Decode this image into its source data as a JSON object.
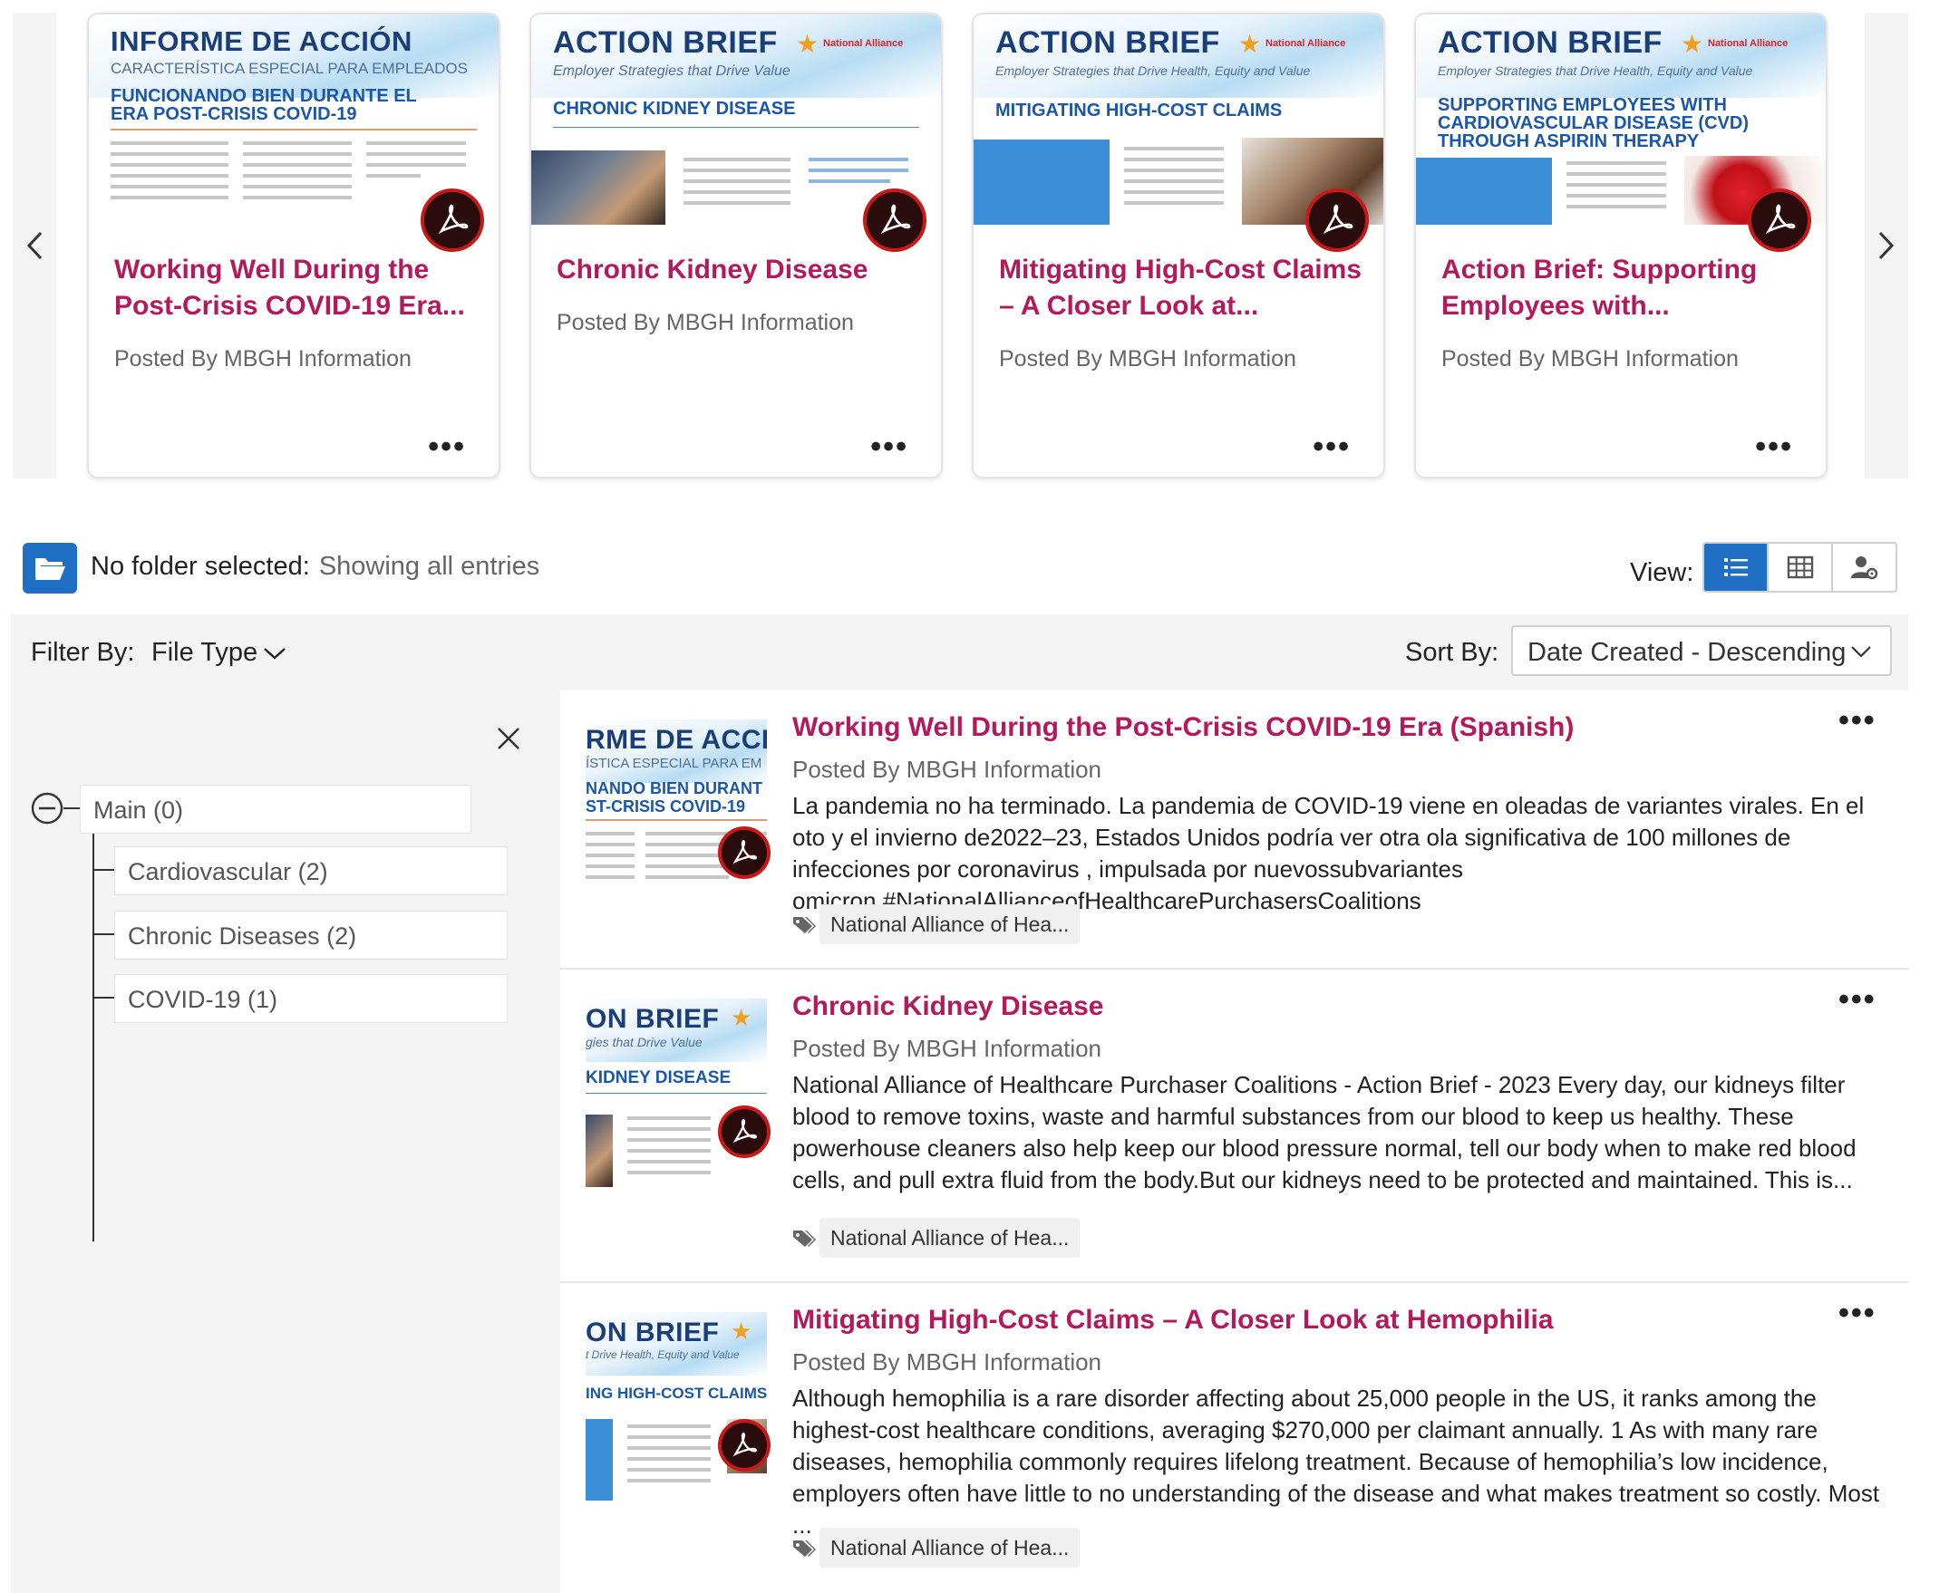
{
  "carousel": {
    "cards": [
      {
        "title": "Working Well During the Post-Crisis COVID-19 Era...",
        "posted": "Posted By MBGH Information",
        "thumb": {
          "h1": "INFORME DE ACCIÓN",
          "h1s": "CARACTERÍSTICA ESPECIAL PARA EMPLEADOS",
          "sub1": "FUNCIONANDO BIEN DURANTE EL",
          "sub2": "ERA POST-CRISIS COVID-19",
          "brand": ""
        }
      },
      {
        "title": "Chronic Kidney Disease",
        "posted": "Posted By MBGH Information",
        "thumb": {
          "h1": "ACTION BRIEF",
          "h1s": "Employer Strategies that Drive Value",
          "sub1": "CHRONIC KIDNEY DISEASE",
          "sub2": "",
          "brand": "National Alliance"
        }
      },
      {
        "title": "Mitigating High-Cost Claims – A Closer Look at...",
        "posted": "Posted By MBGH Information",
        "thumb": {
          "h1": "ACTION BRIEF",
          "h1s": "Employer Strategies that Drive Health, Equity and Value",
          "sub1": "MITIGATING HIGH-COST CLAIMS",
          "sub2": "",
          "brand": "National Alliance"
        }
      },
      {
        "title": "Action Brief: Supporting Employees with...",
        "posted": "Posted By MBGH Information",
        "thumb": {
          "h1": "ACTION BRIEF",
          "h1s": "Employer Strategies that Drive Health, Equity and Value",
          "sub1": "SUPPORTING EMPLOYEES WITH",
          "sub2": "CARDIOVASCULAR DISEASE (CVD)",
          "sub3": "THROUGH ASPIRIN THERAPY",
          "brand": "National Alliance"
        }
      }
    ],
    "more_label": "•••"
  },
  "folder": {
    "label": "No folder selected:",
    "value": "Showing all entries"
  },
  "view": {
    "label": "View:",
    "modes": [
      "list",
      "grid",
      "user-settings"
    ],
    "active": "list"
  },
  "filter": {
    "label": "Filter By:",
    "type_label": "File Type"
  },
  "sort": {
    "label": "Sort By:",
    "value": "Date Created - Descending"
  },
  "tree": {
    "root": "Main (0)",
    "children": [
      "Cardiovascular (2)",
      "Chronic Diseases (2)",
      "COVID-19 (1)"
    ]
  },
  "entries": [
    {
      "title": "Working Well During the Post-Crisis COVID-19 Era (Spanish)",
      "posted": "Posted By MBGH Information",
      "description": "La pandemia no ha terminado. La pandemia de COVID-19 viene en oleadas de variantes virales. En el oto y el invierno de2022–23, Estados Unidos podría ver otra ola significativa de 100 millones de infecciones por coronavirus , impulsada por nuevossubvariantes omicron.#NationalAllianceofHealthcarePurchasersCoalitions",
      "tag": "National Alliance of Hea...",
      "thumb": {
        "h1": "RME DE ACCIÓN",
        "h1s": "ÍSTICA ESPECIAL PARA EM",
        "sub1": "NANDO BIEN DURANT",
        "sub2": "ST-CRISIS COVID-19"
      }
    },
    {
      "title": "Chronic Kidney Disease",
      "posted": "Posted By MBGH Information",
      "description": "National Alliance of Healthcare Purchaser Coalitions - Action Brief - 2023 Every day, our kidneys filter blood to remove toxins, waste and harmful substances from our blood to keep us healthy. These powerhouse cleaners also help keep our blood pressure normal, tell our body when to make red blood cells, and pull extra fluid from the body.But our kidneys need to be protected and maintained. This is...",
      "tag": "National Alliance of Hea...",
      "thumb": {
        "h1": "ON BRIEF",
        "h1s": "gies that Drive Value",
        "sub1": "KIDNEY DISEASE",
        "sub2": ""
      }
    },
    {
      "title": "Mitigating High-Cost Claims – A Closer Look at Hemophilia",
      "posted": "Posted By MBGH Information",
      "description": "Although hemophilia is a rare disorder affecting about 25,000 people in the US, it ranks among the highest-cost healthcare conditions, averaging $270,000 per claimant annually. 1 As with many rare diseases, hemophilia commonly requires lifelong treatment. Because of hemophilia’s low incidence, employers often have little to no understanding of the disease and what makes treatment so costly. Most ...",
      "tag": "National Alliance of Hea...",
      "thumb": {
        "h1": "ON BRIEF",
        "h1s": "t Drive Health, Equity and Value",
        "sub1": "ING HIGH-COST CLAIMS",
        "sub2": ""
      }
    }
  ],
  "entry_more_label": "•••",
  "colors": {
    "accent": "#b3195b",
    "primary": "#1f6fc4",
    "pdf_red": "#c81818"
  }
}
